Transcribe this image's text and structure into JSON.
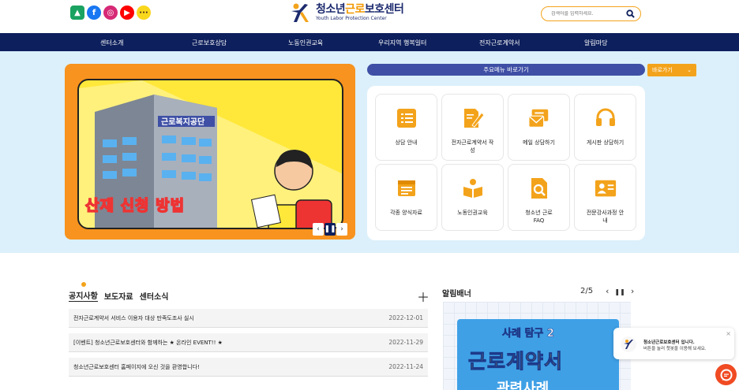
{
  "header": {
    "logo_title_prefix": "청소년",
    "logo_title_highlight": "근로",
    "logo_title_suffix": "보호센터",
    "logo_subtitle": "Youth Labor Protection Center",
    "search_placeholder": "검색어를 입력하세요.",
    "social_icons": [
      "edu-icon",
      "facebook-icon",
      "instagram-icon",
      "youtube-icon",
      "kakaotalk-icon"
    ]
  },
  "nav": {
    "items": [
      "센터소개",
      "근로보호상담",
      "노동인권교육",
      "우리지역 행복일터",
      "전자근로계약서",
      "알림마당"
    ]
  },
  "hero": {
    "banner_sign": "근로복지공단",
    "banner_title": "산재 신청 방법",
    "quick_menu_label": "주요메뉴 바로가기",
    "goto_label": "바로가기",
    "quick_items": [
      {
        "label": "상담 안내",
        "icon": "list-icon"
      },
      {
        "label": "전자근로계약서 작성",
        "icon": "pen-doc-icon"
      },
      {
        "label": "메일 상담하기",
        "icon": "mail-icon"
      },
      {
        "label": "게시판 상담하기",
        "icon": "headset-icon"
      },
      {
        "label": "각종 양식자료",
        "icon": "form-icon"
      },
      {
        "label": "노동인권교육",
        "icon": "book-person-icon"
      },
      {
        "label": "청소년 근로 FAQ",
        "icon": "faq-search-icon"
      },
      {
        "label": "전문강사과정 안내",
        "icon": "id-card-icon"
      }
    ]
  },
  "board": {
    "tabs": [
      "공지사항",
      "보도자료",
      "센터소식"
    ],
    "notices": [
      {
        "title": "전자근로계약서 서비스 이용자 대상 만족도조사 실시",
        "date": "2022-12-01"
      },
      {
        "title": "[이벤트] 청소년근로보호센터와 함께하는 ★ 온라인 EVENT!! ★",
        "date": "2022-11-29"
      },
      {
        "title": "청소년근로보호센터 홈페이지에 오신 것을 환영합니다!",
        "date": "2022-11-24"
      }
    ]
  },
  "alarm": {
    "title": "알림배너",
    "counter": "2/5",
    "card_tag": "사례 탐구 2",
    "card_main": "근로계약서",
    "card_sub": "관련사례"
  },
  "chat": {
    "title": "청소년근로보호센터 입니다.",
    "subtitle": "버튼을 눌러 챗봇을 이용해 보세요."
  },
  "colors": {
    "navy": "#0d1f5c",
    "orange": "#f3a31b",
    "quick_bar": "#3e4fa5",
    "hero_bg": "#dcf0fb"
  }
}
